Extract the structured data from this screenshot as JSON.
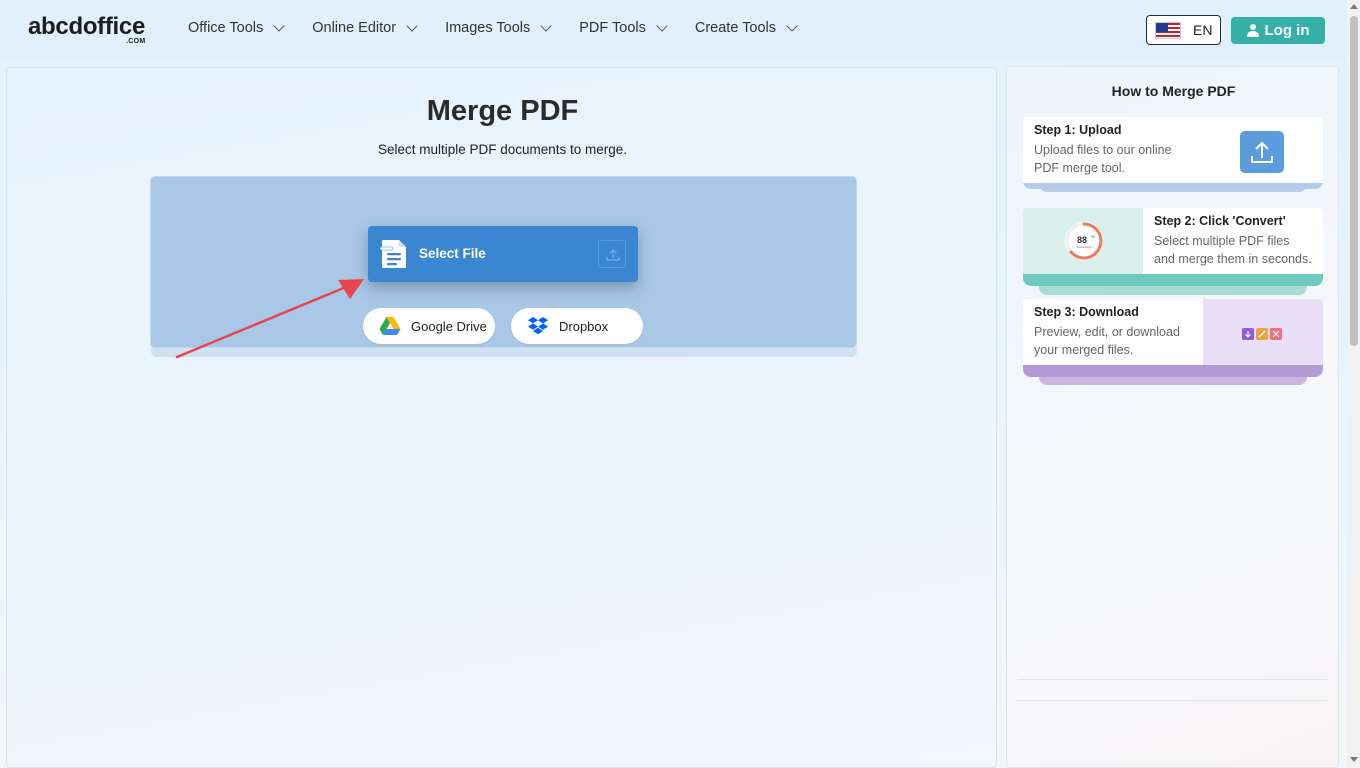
{
  "header": {
    "logo_main": "abcdoffice",
    "logo_sub": ".COM",
    "nav": [
      {
        "label": "Office Tools"
      },
      {
        "label": "Online Editor"
      },
      {
        "label": "Images Tools"
      },
      {
        "label": "PDF Tools"
      },
      {
        "label": "Create Tools"
      }
    ],
    "language": "EN",
    "login_label": "Log in"
  },
  "main": {
    "title": "Merge PDF",
    "subtitle": "Select multiple PDF documents to merge.",
    "select_file_label": "Select File",
    "google_drive_label": "Google Drive",
    "dropbox_label": "Dropbox"
  },
  "sidebar": {
    "title": "How to Merge PDF",
    "steps": [
      {
        "title": "Step 1: Upload",
        "desc_1": "Upload files to our online",
        "desc_2": "PDF merge tool."
      },
      {
        "title": "Step 2: Click 'Convert'",
        "desc_1": "Select multiple PDF files",
        "desc_2": "and merge them in seconds.",
        "progress_value": "88",
        "progress_unit": "%",
        "progress_label": "Converting"
      },
      {
        "title": "Step 3: Download",
        "desc_1": "Preview, edit, or download",
        "desc_2": "your merged files."
      }
    ]
  },
  "colors": {
    "accent_teal": "#35b0a6",
    "select_blue": "#3a86d1",
    "dropzone_blue": "#a9c7e6",
    "arrow_red": "#e8454e"
  },
  "icons": [
    "us-flag-icon",
    "user-icon",
    "document-icon",
    "upload-icon",
    "google-drive-icon",
    "dropbox-icon",
    "chevron-down-icon"
  ]
}
